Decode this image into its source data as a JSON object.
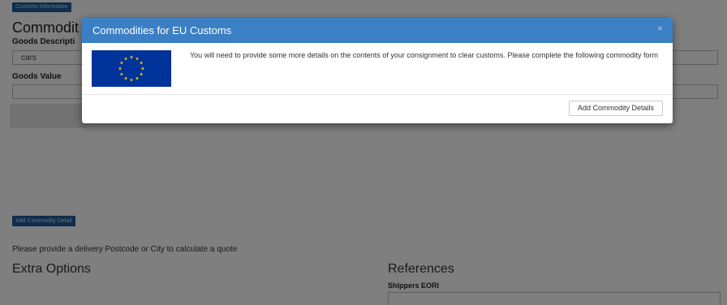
{
  "background": {
    "customs_tab_label": "Customs Information",
    "section_title": "Commodit",
    "goods_description_label": "Goods Descripti",
    "goods_description_value": "cars",
    "goods_value_label": "Goods Value",
    "goods_value_value": "",
    "add_commodity_detail_label": "Add Commodity Detail",
    "postcode_message": "Please provide a delivery Postcode or City to calculate a quote",
    "extra_options_title": "Extra Options",
    "references_title": "References",
    "shippers_eori_label": "Shippers EORI",
    "shippers_eori_value": ""
  },
  "modal": {
    "title": "Commodities for EU Customs",
    "close_symbol": "×",
    "message": "You will need to provide some more details on the contents of your consignment to clear customs. Please complete the following commodity form",
    "add_button_label": "Add Commodity Details",
    "flag_icon": "eu-flag-icon",
    "header_color": "#3b7fc4",
    "flag_blue": "#003399",
    "flag_star_color": "#ffcc00"
  }
}
